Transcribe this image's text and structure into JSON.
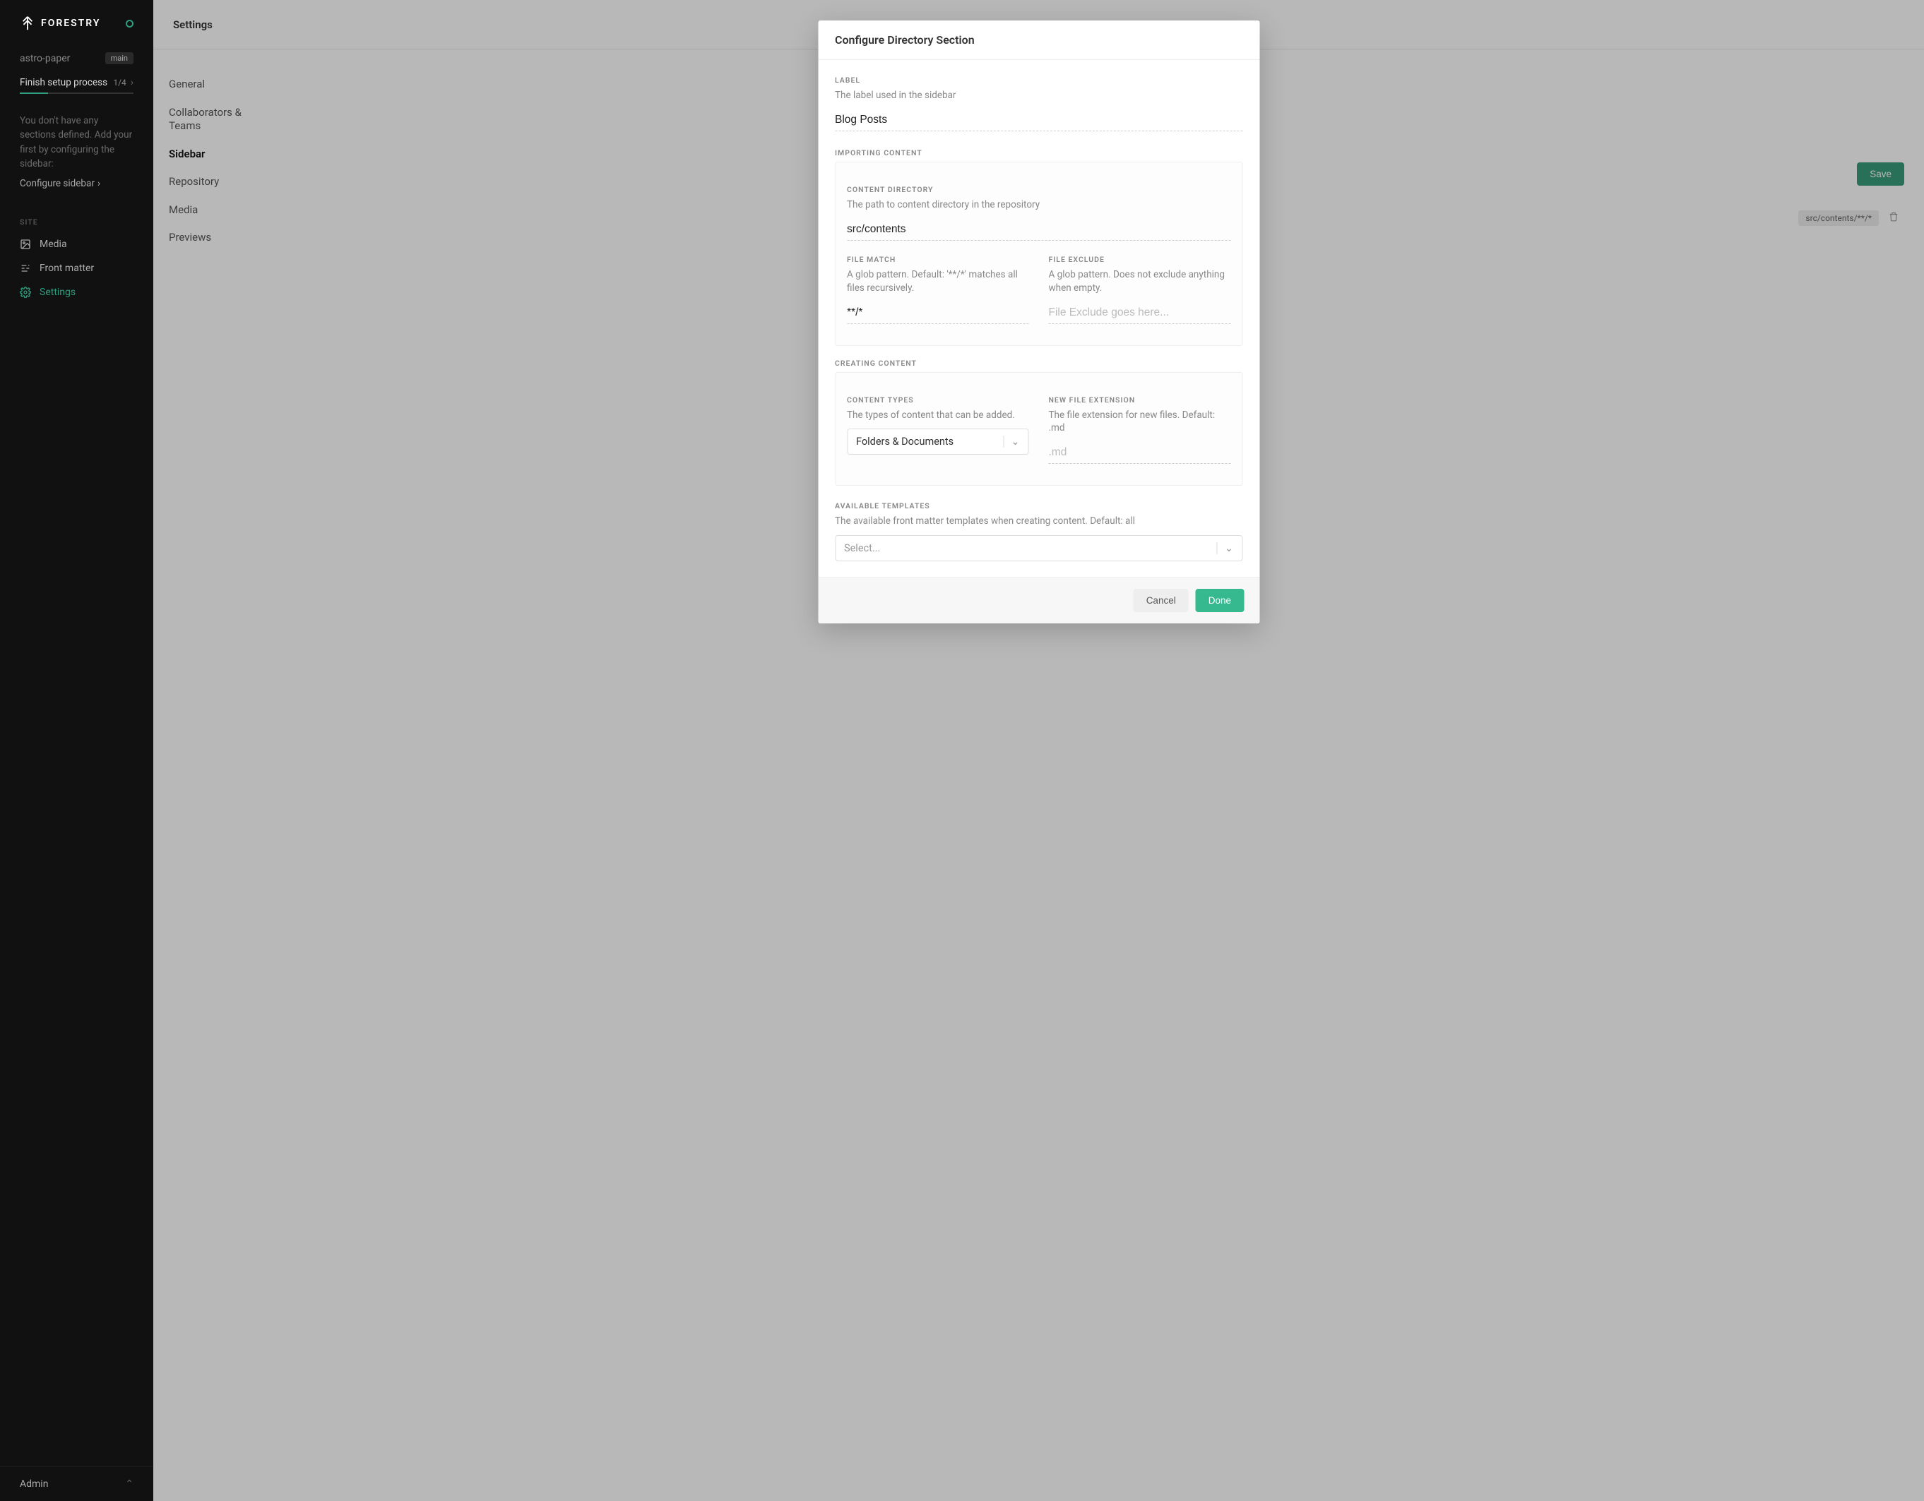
{
  "brand": "FORESTRY",
  "repo": {
    "name": "astro-paper",
    "branch": "main"
  },
  "setup": {
    "label": "Finish setup process",
    "progress": "1/4"
  },
  "noSections": "You don't have any sections defined. Add your first by configuring the sidebar:",
  "configureLink": "Configure sidebar",
  "siteLabel": "SITE",
  "siteItems": {
    "media": "Media",
    "frontMatter": "Front matter",
    "settings": "Settings"
  },
  "userRole": "Admin",
  "header": {
    "title": "Settings"
  },
  "settingsNav": {
    "general": "General",
    "collab": "Collaborators & Teams",
    "sidebar": "Sidebar",
    "repository": "Repository",
    "media": "Media",
    "previews": "Previews"
  },
  "page": {
    "saveBtn": "Save",
    "globChip": "src/contents/**/*"
  },
  "modal": {
    "title": "Configure Directory Section",
    "label": {
      "title": "LABEL",
      "desc": "The label used in the sidebar",
      "value": "Blog Posts"
    },
    "importing": {
      "title": "IMPORTING CONTENT",
      "contentDir": {
        "title": "CONTENT DIRECTORY",
        "desc": "The path to content directory in the repository",
        "value": "src/contents"
      },
      "fileMatch": {
        "title": "FILE MATCH",
        "desc": "A glob pattern. Default: '**/*' matches all files recursively.",
        "value": "**/*"
      },
      "fileExclude": {
        "title": "FILE EXCLUDE",
        "desc": "A glob pattern. Does not exclude anything when empty.",
        "placeholder": "File Exclude goes here..."
      }
    },
    "creating": {
      "title": "CREATING CONTENT",
      "contentTypes": {
        "title": "CONTENT TYPES",
        "desc": "The types of content that can be added.",
        "value": "Folders & Documents"
      },
      "newExt": {
        "title": "NEW FILE EXTENSION",
        "desc": "The file extension for new files. Default: .md",
        "placeholder": ".md"
      }
    },
    "templates": {
      "title": "AVAILABLE TEMPLATES",
      "desc": "The available front matter templates when creating content. Default: all",
      "placeholder": "Select..."
    },
    "buttons": {
      "cancel": "Cancel",
      "done": "Done"
    }
  }
}
